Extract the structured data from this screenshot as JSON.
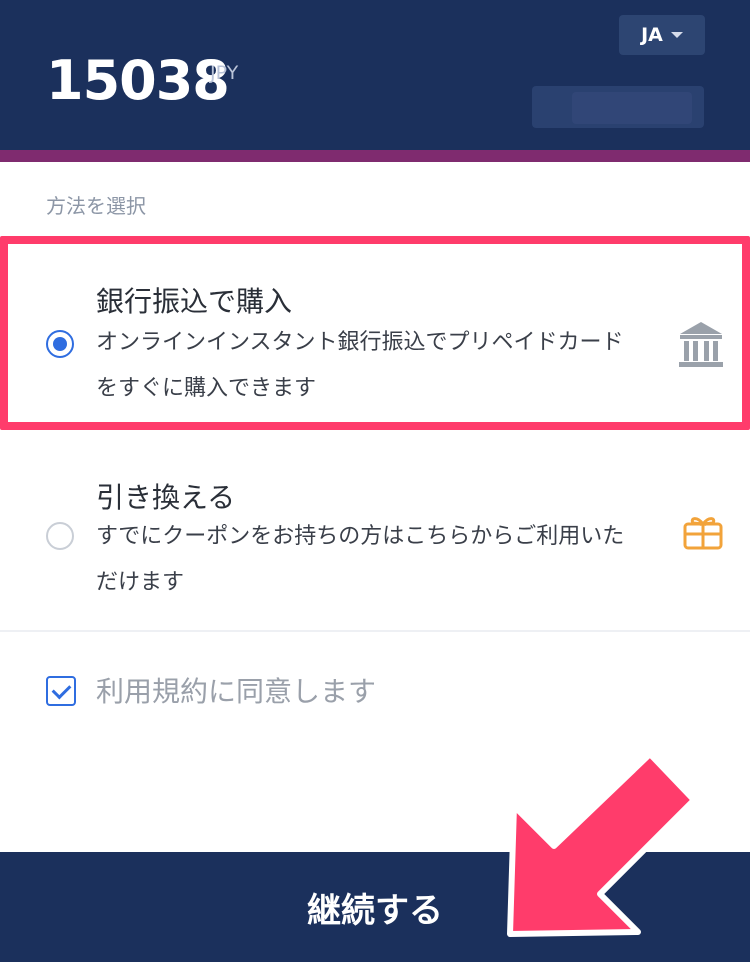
{
  "header": {
    "amount": "15038",
    "currency": "JPY",
    "language": "JA",
    "language_caret_icon": "chevron-down-icon"
  },
  "section": {
    "label": "方法を選択"
  },
  "options": [
    {
      "title": "銀行振込で購入",
      "description": "オンラインインスタント銀行振込でプリペイドカードをすぐに購入できます",
      "selected": true,
      "icon": "bank-icon"
    },
    {
      "title": "引き換える",
      "description": "すでにクーポンをお持ちの方はこちらからご利用いただけます",
      "selected": false,
      "icon": "gift-icon"
    }
  ],
  "terms": {
    "label": "利用規約に同意します",
    "checked": true
  },
  "footer": {
    "continue_label": "継続する"
  },
  "colors": {
    "header_bg": "#1b305c",
    "accent_strip": "#7f2b6f",
    "highlight_border": "#ff3c6b",
    "radio_selected": "#2f6de0",
    "gift_icon": "#f2a33a",
    "arrow": "#ff3c6b"
  }
}
